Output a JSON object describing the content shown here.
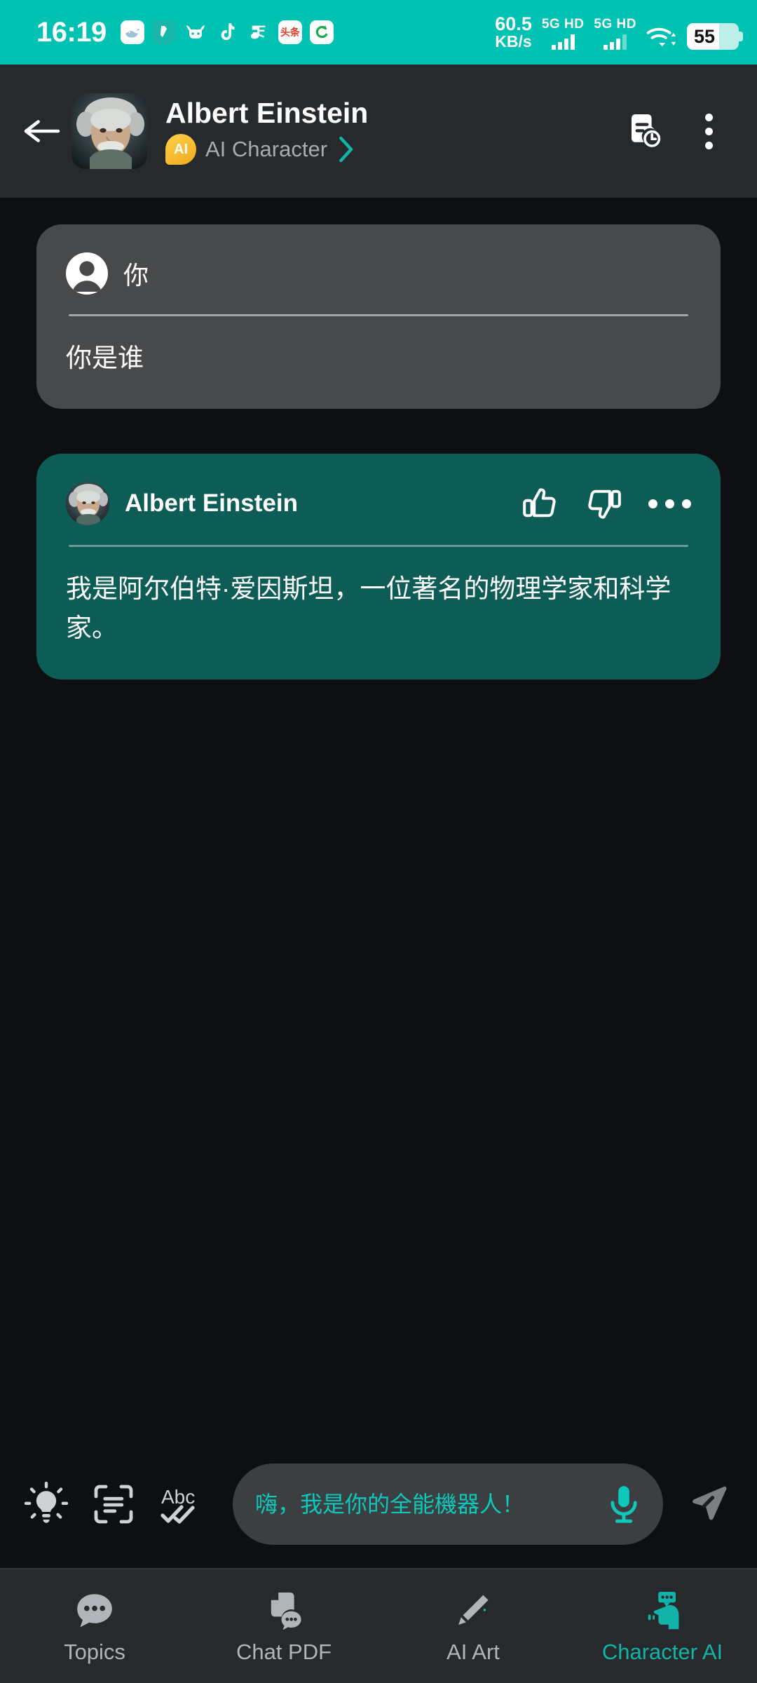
{
  "statusbar": {
    "time": "16:19",
    "notification_icons": [
      "whale-app-icon",
      "note-app-icon",
      "bull-app-icon",
      "tiktok-app-icon",
      "alipay-app-icon",
      "toutiao-app-icon",
      "spiral-app-icon"
    ],
    "toutiao_label": "头条",
    "net_speed_value": "60.5",
    "net_speed_unit": "KB/s",
    "sim1_label": "5G HD",
    "sim2_label": "5G HD",
    "battery_percent": "55",
    "accent": "#00c2b2"
  },
  "header": {
    "back_label": "Back",
    "title": "Albert Einstein",
    "badge_text": "AI",
    "subtitle": "AI Character",
    "chevron": "›",
    "history_label": "Chat history",
    "menu_label": "More options",
    "bg": "#272a2c"
  },
  "messages": [
    {
      "role": "user",
      "sender": "你",
      "text": "你是谁",
      "bg": "#47494b"
    },
    {
      "role": "ai",
      "sender": "Albert Einstein",
      "text": "我是阿尔伯特·爱因斯坦，一位著名的物理学家和科学家。",
      "bg": "#0d5c56",
      "actions": [
        "thumbs-up-icon",
        "thumbs-down-icon",
        "more-horizontal-icon"
      ]
    }
  ],
  "input": {
    "lightbulb_label": "Prompt ideas",
    "scan_label": "Scan text",
    "spellcheck_label": "Abc",
    "value": "嗨，我是你的全能機器人！",
    "placeholder": "嗨，我是你的全能機器人！",
    "text_color": "#0ec8bb",
    "mic_label": "Voice input",
    "send_label": "Send"
  },
  "bottom_nav": {
    "items": [
      {
        "label": "Topics",
        "icon": "topics-icon",
        "active": false
      },
      {
        "label": "Chat PDF",
        "icon": "chat-pdf-icon",
        "active": false
      },
      {
        "label": "AI Art",
        "icon": "ai-art-icon",
        "active": false
      },
      {
        "label": "Character AI",
        "icon": "character-ai-icon",
        "active": true
      }
    ],
    "active_color": "#12b3a8",
    "inactive_color": "#b0b5ba"
  }
}
